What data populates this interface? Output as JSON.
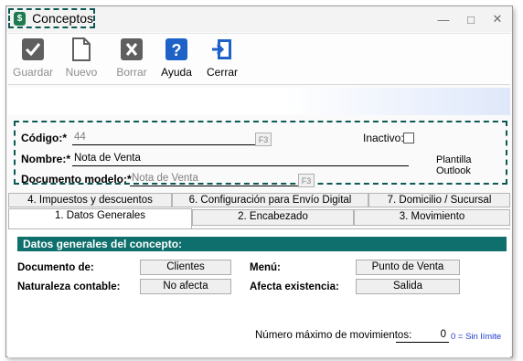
{
  "window": {
    "title": "Conceptos",
    "app_icon": "$"
  },
  "toolbar": {
    "buttons": [
      {
        "label": "Guardar",
        "icon": "check-icon",
        "enabled": false
      },
      {
        "label": "Nuevo",
        "icon": "new-document-icon",
        "enabled": false
      },
      {
        "label": "Borrar",
        "icon": "delete-x-icon",
        "enabled": false
      },
      {
        "label": "Ayuda",
        "icon": "help-question-icon",
        "enabled": true
      },
      {
        "label": "Cerrar",
        "icon": "exit-door-icon",
        "enabled": true
      }
    ]
  },
  "header": {
    "codigo_label": "Código:*",
    "codigo_value": "44",
    "f3": "F3",
    "inactivo_label": "Inactivo:",
    "nombre_label": "Nombre:*",
    "nombre_value": "Nota de Venta",
    "plantilla_label": "Plantilla Outlook",
    "documento_label": "Documento modelo:*",
    "documento_value": "Nota de Venta"
  },
  "tabs_row1": [
    "4. Impuestos y descuentos",
    "6. Configuración para Envío Digital",
    "7. Domicilio / Sucursal"
  ],
  "tabs_row2": [
    "1. Datos Generales",
    "2. Encabezado",
    "3. Movimiento"
  ],
  "general": {
    "section_title": "Datos generales del concepto:",
    "documento_de_label": "Documento de:",
    "documento_de_value": "Clientes",
    "menu_label": "Menú:",
    "menu_value": "Punto de Venta",
    "naturaleza_label": "Naturaleza contable:",
    "naturaleza_value": "No afecta",
    "afecta_label": "Afecta existencia:",
    "afecta_value": "Salida",
    "max_mov_label": "Número máximo de movimientos:",
    "max_mov_value": "0",
    "max_mov_note": "0 = Sin límite"
  },
  "colors": {
    "accent_teal": "#0e6f6c",
    "annotation_dashed": "#0d5a55",
    "help_blue": "#1e62c8"
  }
}
